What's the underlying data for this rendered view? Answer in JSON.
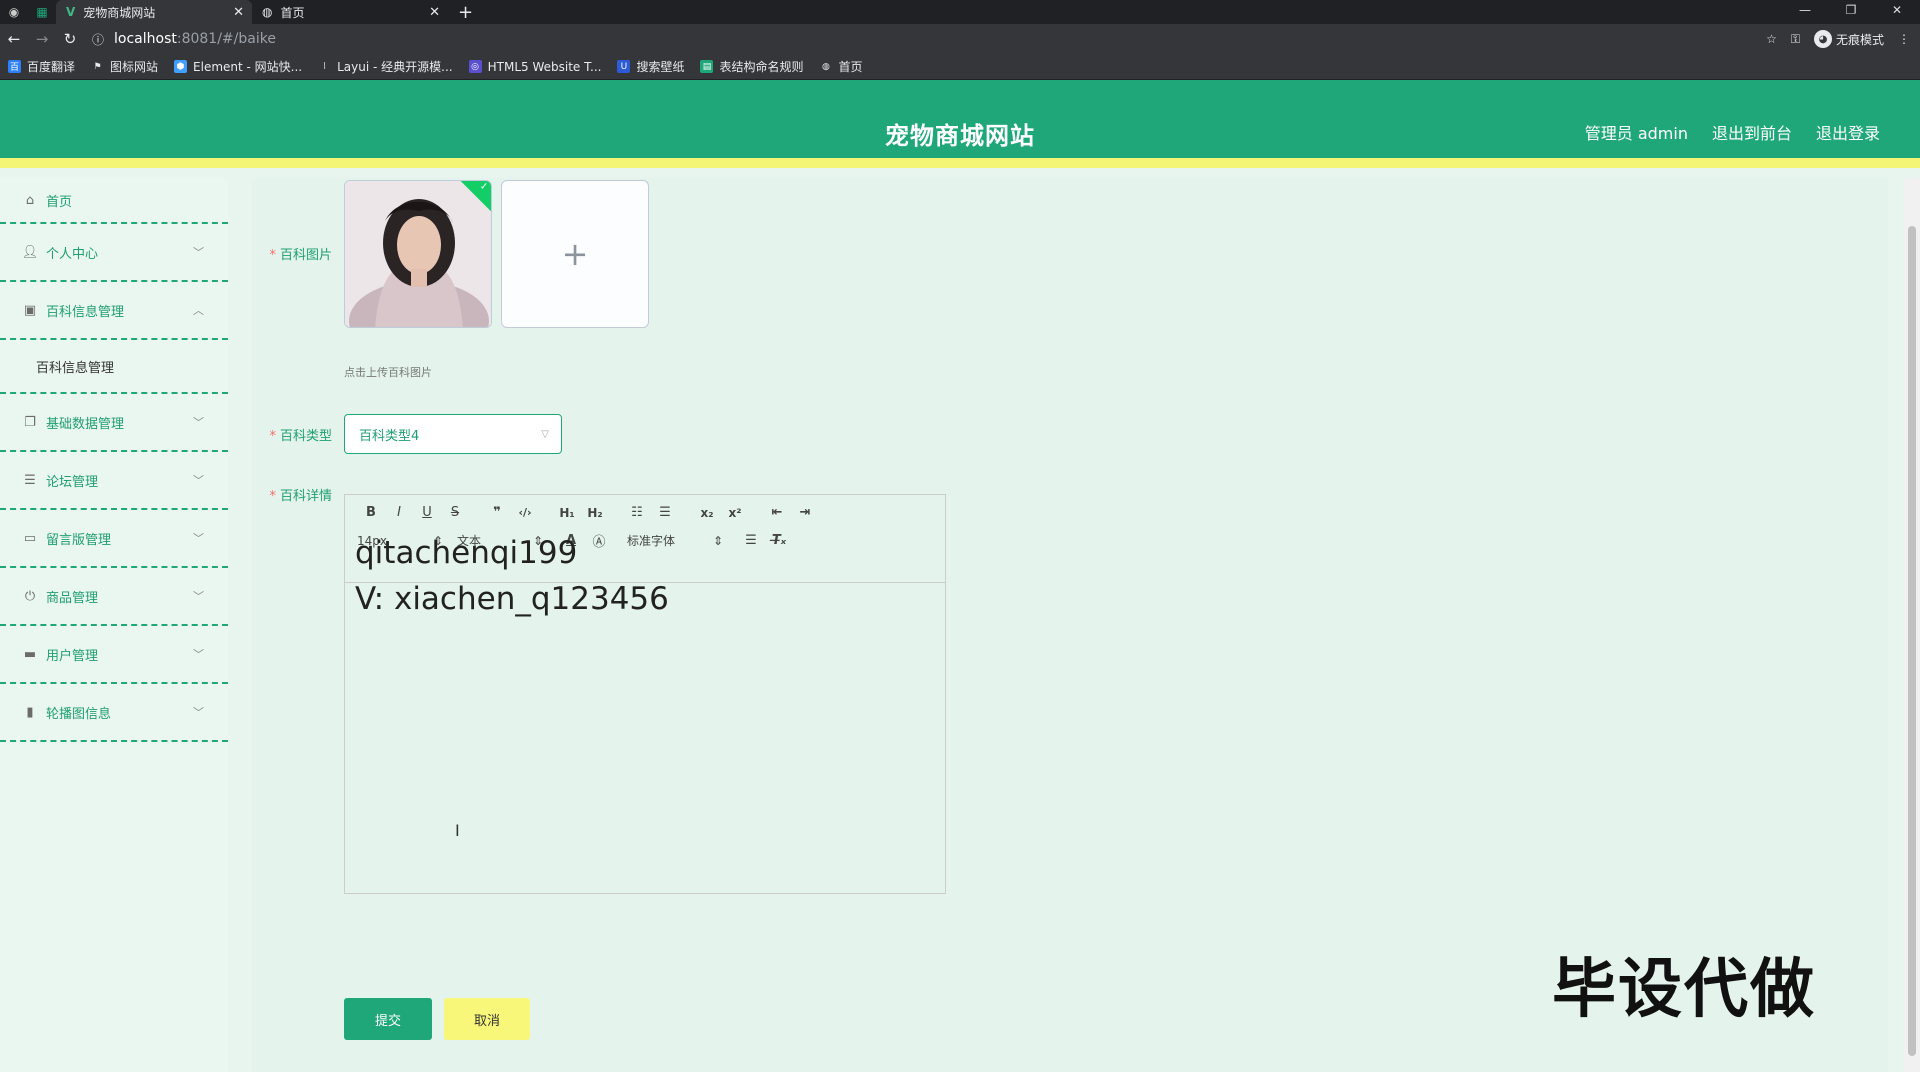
{
  "browser": {
    "tabs": [
      {
        "title": "宠物商城网站",
        "active": true
      },
      {
        "title": "首页",
        "active": false
      }
    ],
    "url_host": "localhost",
    "url_path": ":8081/#/baike",
    "incognito_label": "无痕模式",
    "bookmarks": [
      {
        "label": "百度翻译",
        "color": "#2d7ff9"
      },
      {
        "label": "图标网站",
        "color": "#666666"
      },
      {
        "label": "Element - 网站快...",
        "color": "#409eff"
      },
      {
        "label": "Layui - 经典开源模...",
        "color": "#999999"
      },
      {
        "label": "HTML5 Website T...",
        "color": "#5a4fcf"
      },
      {
        "label": "搜索壁纸",
        "color": "#2d5bd8"
      },
      {
        "label": "表结构命名规则",
        "color": "#1fa77a"
      },
      {
        "label": "首页",
        "color": "#888888"
      }
    ]
  },
  "header": {
    "title": "宠物商城网站",
    "admin": "管理员 admin",
    "exit_front": "退出到前台",
    "logout": "退出登录",
    "bg_color": "#1fa77a",
    "accent_color": "#f5f575"
  },
  "sidebar": {
    "items": [
      {
        "label": "首页",
        "icon": "home-icon"
      },
      {
        "label": "个人中心",
        "icon": "user-icon"
      },
      {
        "label": "百科信息管理",
        "icon": "doc-icon",
        "expanded": true
      },
      {
        "label": "基础数据管理",
        "icon": "copy-icon"
      },
      {
        "label": "论坛管理",
        "icon": "sliders-icon"
      },
      {
        "label": "留言版管理",
        "icon": "chat-icon"
      },
      {
        "label": "商品管理",
        "icon": "power-icon"
      },
      {
        "label": "用户管理",
        "icon": "briefcase-icon"
      },
      {
        "label": "轮播图信息",
        "icon": "chart-icon"
      }
    ],
    "submenu": {
      "label": "百科信息管理"
    }
  },
  "form": {
    "image_label": "百科图片",
    "upload_tip": "点击上传百科图片",
    "type_label": "百科类型",
    "type_value": "百科类型4",
    "detail_label": "百科详情",
    "toolbar": {
      "font_size": "14px",
      "heading": "文本",
      "font_family": "标准字体"
    },
    "overlay_line1": "qitachenqi199",
    "overlay_line2": "V: xiachen_q123456",
    "submit": "提交",
    "cancel": "取消"
  },
  "watermark": "毕设代做"
}
